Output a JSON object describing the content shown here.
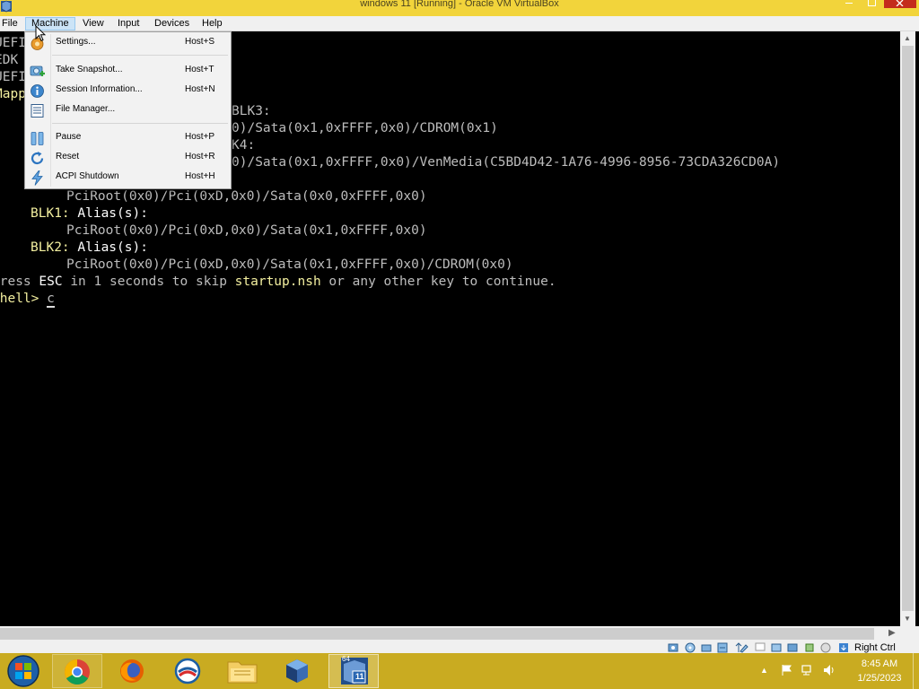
{
  "window": {
    "title": "windows 11 [Running] - Oracle VM VirtualBox",
    "close_color": "#c42b1c",
    "frame_color": "#f2d43b"
  },
  "menubar": {
    "items": [
      "File",
      "Machine",
      "View",
      "Input",
      "Devices",
      "Help"
    ],
    "active": "Machine"
  },
  "machine_menu": {
    "items": [
      {
        "label": "Settings...",
        "shortcut": "Host+S",
        "icon": "settings-icon"
      },
      {
        "label": "Take Snapshot...",
        "shortcut": "Host+T",
        "icon": "snapshot-icon"
      },
      {
        "label": "Session Information...",
        "shortcut": "Host+N",
        "icon": "info-icon"
      },
      {
        "label": "File Manager...",
        "shortcut": "",
        "icon": "file-manager-icon"
      },
      {
        "label": "Pause",
        "shortcut": "Host+P",
        "icon": "pause-icon"
      },
      {
        "label": "Reset",
        "shortcut": "Host+R",
        "icon": "reset-icon"
      },
      {
        "label": "ACPI Shutdown",
        "shortcut": "Host+H",
        "icon": "acpi-shutdown-icon"
      }
    ]
  },
  "console": {
    "lines": {
      "l1": "UEFI",
      "l2": "EDK",
      "l3": "UEFI",
      "l4": "Mapp",
      "l5": "BLK3:",
      "l6": "0)/Sata(0x1,0xFFFF,0x0)/CDROM(0x1)",
      "l7": "K4:",
      "l8": "0)/Sata(0x1,0xFFFF,0x0)/VenMedia(C5BD4D42-1A76-4996-8956-73CDA326CD0A)",
      "l9": "PciRoot(0x0)/Pci(0xD,0x0)/Sata(0x0,0xFFFF,0x0)",
      "blk1_name": "BLK1:",
      "blk1_alias": " Alias(s):",
      "l11": "PciRoot(0x0)/Pci(0xD,0x0)/Sata(0x1,0xFFFF,0x0)",
      "blk2_name": "BLK2:",
      "blk2_alias": " Alias(s):",
      "l13": "PciRoot(0x0)/Pci(0xD,0x0)/Sata(0x1,0xFFFF,0x0)/CDROM(0x0)",
      "press_a": "Press ",
      "press_esc": "ESC",
      "press_b": " in 1 seconds to skip ",
      "press_file": "startup.nsh",
      "press_c": " or any other key to continue.",
      "shell_prompt": "Shell> ",
      "shell_input": "c"
    },
    "text_color": "#bdbdbd",
    "highlight_color": "#f4f0a0"
  },
  "statusbar": {
    "host_key": "Right Ctrl"
  },
  "taskbar": {
    "apps": [
      "start-button",
      "chrome",
      "firefox",
      "edge-like",
      "file-explorer",
      "virtualbox",
      "virtualbox-vm-window"
    ],
    "vm_badge_top": "64",
    "vm_badge_num": "11",
    "time": "8:45 AM",
    "date": "1/25/2023"
  }
}
